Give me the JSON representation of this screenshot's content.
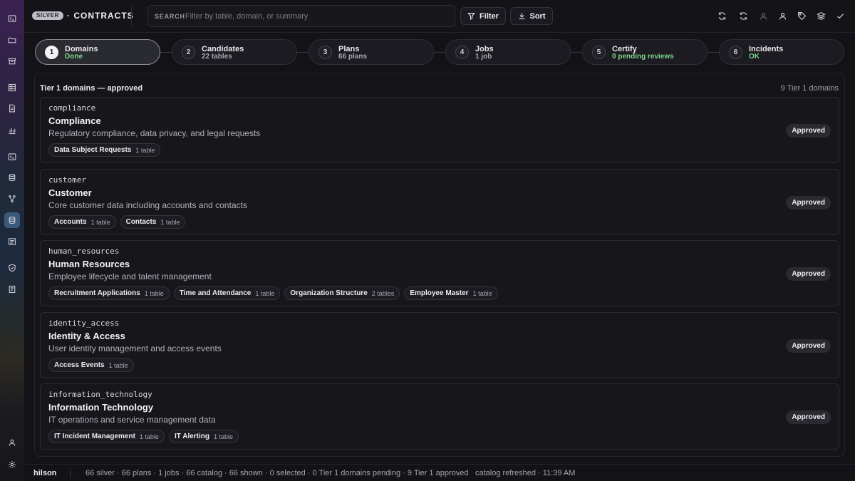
{
  "header": {
    "tier_badge": "SILVER",
    "title": "· CONTRACTS",
    "search_label": "SEARCH",
    "search_placeholder": "Filter by table, domain, or summary",
    "filter_label": "Filter",
    "sort_label": "Sort"
  },
  "stepper": [
    {
      "num": "1",
      "title": "Domains",
      "sub": "Done",
      "active": true
    },
    {
      "num": "2",
      "title": "Candidates",
      "sub": "22 tables"
    },
    {
      "num": "3",
      "title": "Plans",
      "sub": "66 plans"
    },
    {
      "num": "4",
      "title": "Jobs",
      "sub": "1 job"
    },
    {
      "num": "5",
      "title": "Certify",
      "sub": "0 pending reviews",
      "sub_color": "green"
    },
    {
      "num": "6",
      "title": "Incidents",
      "sub": "OK",
      "sub_color": "green"
    }
  ],
  "panel": {
    "title": "Tier 1 domains — approved",
    "count": "9 Tier 1 domains"
  },
  "domains": [
    {
      "key": "compliance",
      "name": "Compliance",
      "desc": "Regulatory compliance, data privacy, and legal requests",
      "status": "Approved",
      "chips": [
        {
          "name": "Data Subject Requests",
          "count": "1 table"
        }
      ]
    },
    {
      "key": "customer",
      "name": "Customer",
      "desc": "Core customer data including accounts and contacts",
      "status": "Approved",
      "chips": [
        {
          "name": "Accounts",
          "count": "1 table"
        },
        {
          "name": "Contacts",
          "count": "1 table"
        }
      ]
    },
    {
      "key": "human_resources",
      "name": "Human Resources",
      "desc": "Employee lifecycle and talent management",
      "status": "Approved",
      "chips": [
        {
          "name": "Recruitment Applications",
          "count": "1 table"
        },
        {
          "name": "Time and Attendance",
          "count": "1 table"
        },
        {
          "name": "Organization Structure",
          "count": "2 tables"
        },
        {
          "name": "Employee Master",
          "count": "1 table"
        }
      ]
    },
    {
      "key": "identity_access",
      "name": "Identity & Access",
      "desc": "User identity management and access events",
      "status": "Approved",
      "chips": [
        {
          "name": "Access Events",
          "count": "1 table"
        }
      ]
    },
    {
      "key": "information_technology",
      "name": "Information Technology",
      "desc": "IT operations and service management data",
      "status": "Approved",
      "chips": [
        {
          "name": "IT Incident Management",
          "count": "1 table"
        },
        {
          "name": "IT Alerting",
          "count": "1 table"
        }
      ]
    }
  ],
  "statusbar": {
    "user": "hilson",
    "summary": "66 silver · 66 plans · 1 jobs · 66 catalog · 66 shown · 0 selected · 0 Tier 1 domains pending · 9 Tier 1 approved",
    "refreshed": "catalog refreshed · 11:39 AM"
  },
  "colors": {
    "accent_green": "#7ed58b",
    "active_rail": "#3b5a78"
  },
  "icons": {
    "rail": [
      "terminal-icon",
      "folder-icon",
      "archive-icon",
      "grid-icon",
      "document-icon",
      "bar-chart-icon",
      "terminal-icon",
      "database-icon",
      "branch-icon",
      "database-icon",
      "list-icon",
      "shield-icon",
      "notebook-icon",
      "user-icon",
      "gear-icon"
    ],
    "toolbar": [
      "refresh-icon",
      "sync-icon",
      "user-outline-icon",
      "user-icon",
      "tag-icon",
      "layers-icon",
      "check-icon"
    ]
  }
}
